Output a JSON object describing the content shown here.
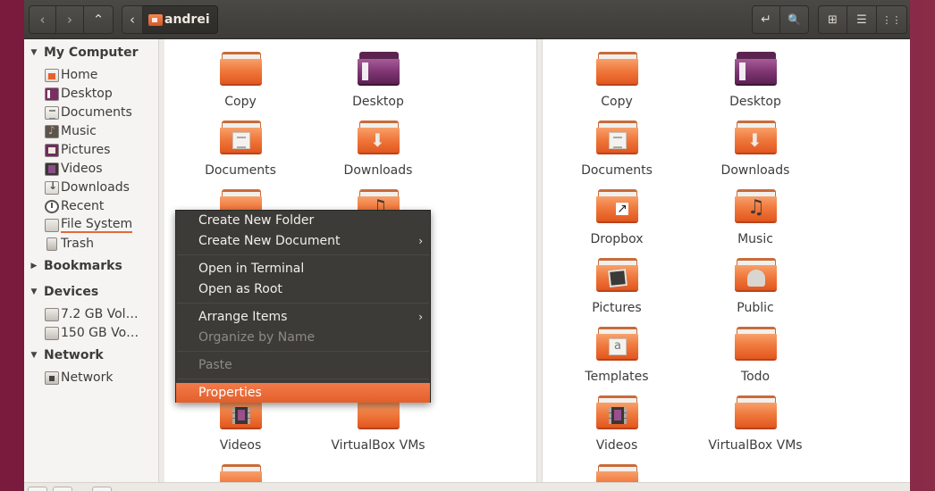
{
  "header": {
    "back_icon": "‹",
    "forward_icon": "›",
    "up_icon": "⌃",
    "path_prev_icon": "‹",
    "path_label": "andrei",
    "search_icon": "🔍",
    "enter_path_icon": "↵",
    "view_grid_icon": "⊞",
    "view_list_icon": "☰",
    "view_compact_icon": "⋮⋮"
  },
  "sidebar": {
    "my_computer": "My Computer",
    "items": [
      {
        "label": "Home",
        "icon": "home-icon"
      },
      {
        "label": "Desktop",
        "icon": "desktop-icon"
      },
      {
        "label": "Documents",
        "icon": "documents-icon"
      },
      {
        "label": "Music",
        "icon": "music-icon"
      },
      {
        "label": "Pictures",
        "icon": "pictures-icon"
      },
      {
        "label": "Videos",
        "icon": "videos-icon"
      },
      {
        "label": "Downloads",
        "icon": "downloads-icon"
      },
      {
        "label": "Recent",
        "icon": "recent-icon"
      },
      {
        "label": "File System",
        "icon": "file-system-icon"
      },
      {
        "label": "Trash",
        "icon": "trash-icon"
      }
    ],
    "bookmarks": "Bookmarks",
    "devices": "Devices",
    "device_items": [
      {
        "label": "7.2 GB Vol…"
      },
      {
        "label": "150 GB Vo…"
      }
    ],
    "network": "Network",
    "network_items": [
      {
        "label": "Network"
      }
    ]
  },
  "left_pane": {
    "items": [
      "Copy",
      "Desktop",
      "Documents",
      "Downloads",
      "Videos",
      "VirtualBox VMs"
    ]
  },
  "right_pane": {
    "items": [
      "Copy",
      "Desktop",
      "Documents",
      "Downloads",
      "Dropbox",
      "Music",
      "Pictures",
      "Public",
      "Templates",
      "Todo",
      "Videos",
      "VirtualBox VMs"
    ]
  },
  "context_menu": {
    "create_folder": "Create New Folder",
    "create_document": "Create New Document",
    "open_terminal": "Open in Terminal",
    "open_root": "Open as Root",
    "arrange_items": "Arrange Items",
    "organize_by_name": "Organize by Name",
    "paste": "Paste",
    "properties": "Properties",
    "submenu_arrow": "›"
  },
  "colors": {
    "accent": "#f07a3e",
    "menu_bg": "#3c3b37",
    "headerbar": "#3d3c38"
  }
}
